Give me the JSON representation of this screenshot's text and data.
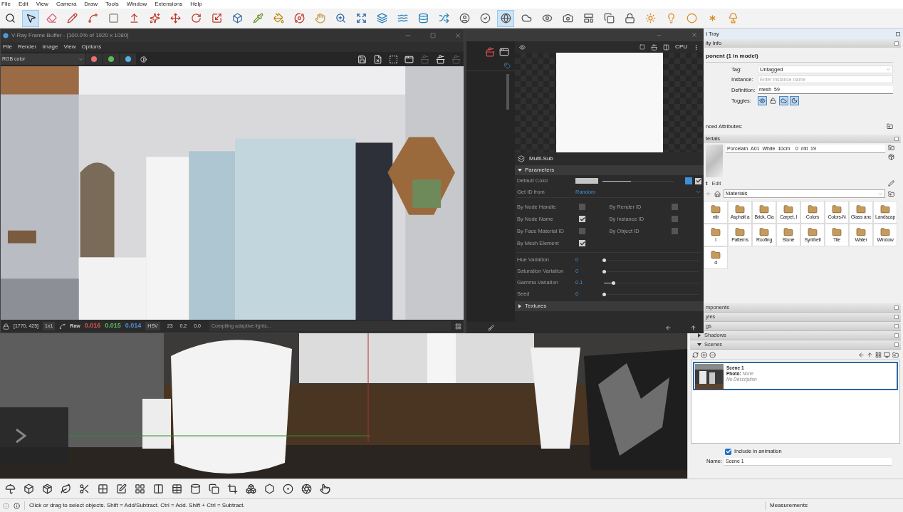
{
  "menu": [
    "File",
    "Edit",
    "View",
    "Camera",
    "Draw",
    "Tools",
    "Window",
    "Extensions",
    "Help"
  ],
  "toolbar": [
    {
      "selected": false
    },
    {
      "selected": true
    },
    {
      "selected": false
    },
    {
      "selected": false
    },
    {
      "selected": false
    },
    {
      "selected": false
    },
    {
      "selected": false
    },
    {
      "selected": false
    },
    {
      "selected": false
    },
    {
      "selected": false
    },
    {
      "selected": false
    },
    {
      "selected": false
    },
    {
      "selected": false
    },
    {
      "selected": false
    },
    {
      "selected": false
    },
    {
      "selected": false
    },
    {
      "selected": false
    },
    {
      "selected": false
    },
    {
      "selected": false
    },
    {
      "selected": false
    },
    {
      "selected": false
    },
    {
      "selected": false
    },
    {
      "selected": false
    },
    {
      "selected": false
    },
    {
      "selected": true
    },
    {
      "selected": false
    },
    {
      "selected": false
    },
    {
      "selected": false
    },
    {
      "selected": false
    },
    {
      "selected": false
    },
    {
      "selected": false
    },
    {
      "selected": false
    },
    {
      "selected": false
    },
    {
      "selected": false
    },
    {
      "selected": false
    },
    {
      "selected": false
    }
  ],
  "vfb": {
    "title": "V-Ray Frame Buffer - [100.0% of 1920 x 1080]",
    "menu": [
      "File",
      "Render",
      "Image",
      "View",
      "Options"
    ],
    "channel": "RGB color",
    "channels": [
      {
        "color": "#e57373"
      },
      {
        "color": "#5cb85c"
      },
      {
        "color": "#4fb3e8"
      }
    ],
    "status": {
      "coords": "[1770, 425]",
      "zoom": "1x1",
      "mode": "Raw",
      "values": [
        {
          "text": "0.016",
          "color": "#d9534f"
        },
        {
          "text": "0.015",
          "color": "#5cb85c"
        },
        {
          "text": "0.014",
          "color": "#4a90d9"
        }
      ],
      "space": "HSV",
      "readings": [
        "23",
        "0.2",
        "0.0"
      ],
      "message": "Compiling adaptive lights..."
    }
  },
  "asset_editor": {
    "renderer": "CPU",
    "material": "Multi-Sub",
    "sections": [
      {
        "title": "Parameters",
        "expanded": true
      },
      {
        "title": "Textures",
        "expanded": false
      }
    ],
    "default_color": {
      "label": "Default Color",
      "level": 0.4,
      "checked": true
    },
    "id_from": {
      "label": "Get ID from",
      "value": "Random"
    },
    "options": [
      {
        "label": "By Node Handle",
        "checked": false
      },
      {
        "label": "By Render ID",
        "checked": false
      },
      {
        "label": "By Node Name",
        "checked": true
      },
      {
        "label": "By Instance ID",
        "checked": false
      },
      {
        "label": "By Face Material ID",
        "checked": false
      },
      {
        "label": "By Object ID",
        "checked": false
      },
      {
        "label": "By Mesh Element",
        "checked": true
      }
    ],
    "variations": [
      {
        "label": "Hue Variation",
        "value": "0",
        "level": 0
      },
      {
        "label": "Saturation Variation",
        "value": "0",
        "level": 0
      },
      {
        "label": "Gamma Variation",
        "value": "0.1",
        "level": 0.1
      },
      {
        "label": "Seed",
        "value": "0",
        "level": 0
      }
    ]
  },
  "tray": {
    "title": "t Tray",
    "entity_info": {
      "header": "ity Info",
      "heading": "ponent (1 in model)",
      "tag_label": "Tag:",
      "tag": "Untagged",
      "instance_label": "Instance:",
      "instance_placeholder": "Enter instance name",
      "definition_label": "Definition:",
      "definition": "mesh_59",
      "toggles_label": "Toggles:",
      "toggles": [
        {
          "on": true
        },
        {
          "on": false
        },
        {
          "on": true
        },
        {
          "on": true
        }
      ],
      "advanced": "nced Attributes:"
    },
    "materials": {
      "header": "terials",
      "name": "Porcelain_A01_White_10cm__0_mtl_19",
      "tabs": [
        {
          "label": "t",
          "selected": true
        },
        {
          "label": "Edit",
          "selected": false
        }
      ],
      "library": "Materials",
      "folders": [
        {
          "label": "ntir"
        },
        {
          "label": "Asphalt a"
        },
        {
          "label": "Brick, Cla"
        },
        {
          "label": "Carpet, I"
        },
        {
          "label": "Colors"
        },
        {
          "label": "Colors-N"
        },
        {
          "label": "Glass anc"
        },
        {
          "label": "Landscap"
        },
        {
          "label": "l"
        },
        {
          "label": "Patterns"
        },
        {
          "label": "Roofing"
        },
        {
          "label": "Stone"
        },
        {
          "label": "Syntheti"
        },
        {
          "label": "Tile"
        },
        {
          "label": "Water"
        },
        {
          "label": "Window"
        },
        {
          "label": "d"
        }
      ]
    },
    "panels": [
      {
        "title": "mponents"
      },
      {
        "title": "yles"
      },
      {
        "title": "gs"
      },
      {
        "title": "Shadows",
        "expanded": false
      },
      {
        "title": "Scenes",
        "expanded": true
      }
    ],
    "scenes": {
      "items": [
        {
          "name": "Scene 1",
          "photo_label": "Photo:",
          "photo": "None",
          "description": "No Description",
          "selected": true
        }
      ],
      "include": {
        "label": "Include in animation",
        "checked": true
      },
      "name_label": "Name:",
      "name": "Scene 1"
    }
  },
  "status_bar": {
    "message": "Click or drag to select objects. Shift = Add/Subtract. Ctrl = Add. Shift + Ctrl = Subtract.",
    "measurements": "Measurements"
  }
}
